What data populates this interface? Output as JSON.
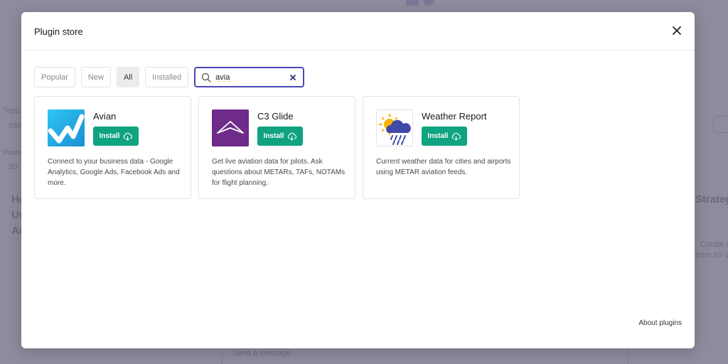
{
  "modal": {
    "title": "Plugin store",
    "about_link": "About plugins"
  },
  "filters": [
    {
      "label": "Popular",
      "active": false
    },
    {
      "label": "New",
      "active": false
    },
    {
      "label": "All",
      "active": true
    },
    {
      "label": "Installed",
      "active": false
    }
  ],
  "search": {
    "value": "avia"
  },
  "plugins": [
    {
      "name": "Avian",
      "install_label": "Install",
      "description": "Connect to your business data - Google Analytics, Google Ads, Facebook Ads and more.",
      "icon": "avian-logo"
    },
    {
      "name": "C3 Glide",
      "install_label": "Install",
      "description": "Get live aviation data for pilots. Ask questions about METARs, TAFs, NOTAMs for flight planning.",
      "icon": "c3-glide-logo"
    },
    {
      "name": "Weather Report",
      "install_label": "Install",
      "description": "Current weather data for cities and airports using METAR aviation feeds.",
      "icon": "weather-storm-logo"
    }
  ],
  "background": {
    "message_placeholder": "Send a message",
    "labels": [
      "Topic",
      "560",
      "Prom",
      "20",
      "Ho",
      "Us",
      "An",
      "Strateg",
      "Create a",
      "from 10-1"
    ]
  },
  "colors": {
    "accent": "#10a37f",
    "search_border": "#4b46b8",
    "overlay": "#8d8b9c",
    "c3_glide_bg": "#6e2b8a",
    "avian_bg": "#1bb5ec"
  }
}
